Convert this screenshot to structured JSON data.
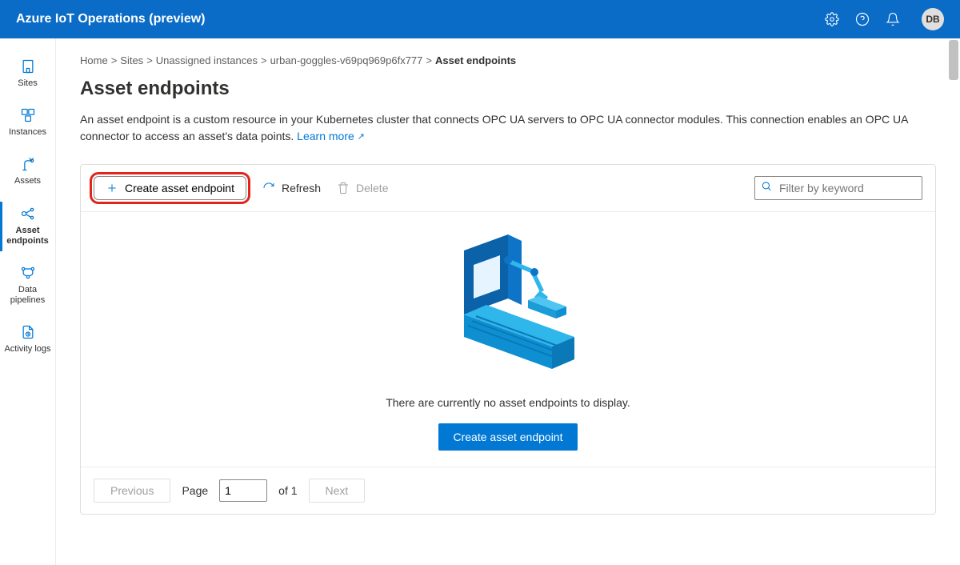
{
  "header": {
    "product_title": "Azure IoT Operations (preview)",
    "avatar_initials": "DB"
  },
  "nav": {
    "items": [
      {
        "label": "Sites"
      },
      {
        "label": "Instances"
      },
      {
        "label": "Assets"
      },
      {
        "label": "Asset endpoints"
      },
      {
        "label": "Data pipelines"
      },
      {
        "label": "Activity logs"
      }
    ],
    "selected_index": 3
  },
  "breadcrumb": {
    "items": [
      {
        "label": "Home"
      },
      {
        "label": "Sites"
      },
      {
        "label": "Unassigned instances"
      },
      {
        "label": "urban-goggles-v69pq969p6fx777"
      },
      {
        "label": "Asset endpoints"
      }
    ]
  },
  "page": {
    "title": "Asset endpoints",
    "description": "An asset endpoint is a custom resource in your Kubernetes cluster that connects OPC UA servers to OPC UA connector modules. This connection enables an OPC UA connector to access an asset's data points. ",
    "learn_more_label": "Learn more"
  },
  "toolbar": {
    "create_label": "Create asset endpoint",
    "refresh_label": "Refresh",
    "delete_label": "Delete",
    "search_placeholder": "Filter by keyword"
  },
  "empty_state": {
    "message": "There are currently no asset endpoints to display.",
    "cta_label": "Create asset endpoint"
  },
  "pager": {
    "previous_label": "Previous",
    "next_label": "Next",
    "page_label": "Page",
    "current_page": "1",
    "of_label": "of 1"
  }
}
